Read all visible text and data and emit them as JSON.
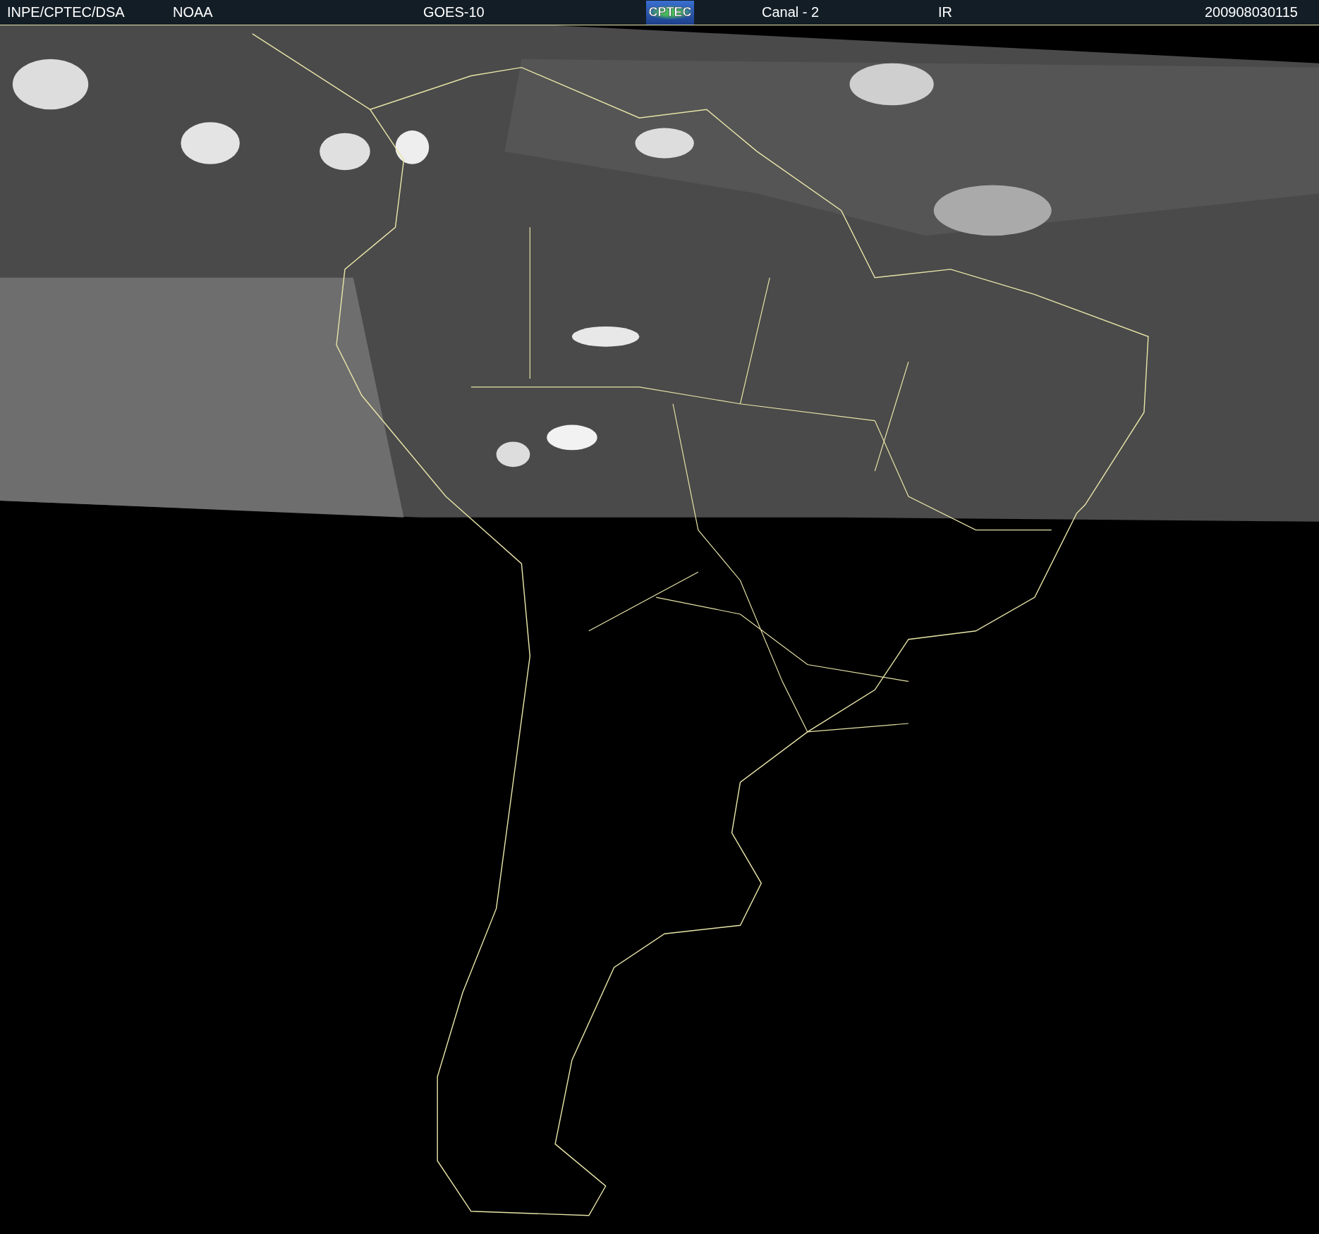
{
  "header": {
    "items": [
      {
        "kind": "text",
        "text": "INPE/CPTEC/DSA"
      },
      {
        "kind": "text",
        "text": "NOAA"
      },
      {
        "kind": "text",
        "text": "GOES-10"
      },
      {
        "kind": "logo",
        "text": "CPTEC"
      },
      {
        "kind": "text",
        "text": "Canal - 2"
      },
      {
        "kind": "text",
        "text": "IR"
      },
      {
        "kind": "text",
        "text": "200908030115"
      }
    ]
  }
}
